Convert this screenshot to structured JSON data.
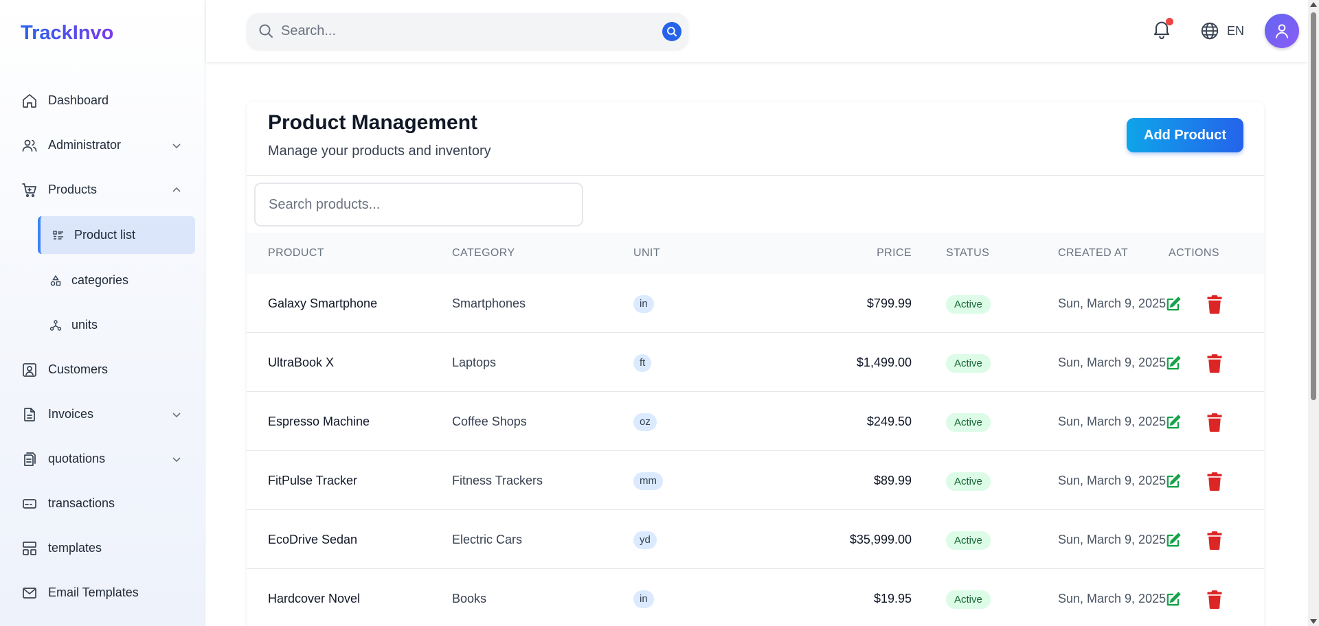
{
  "brand": "TrackInvo",
  "sidebar": {
    "items": [
      {
        "label": "Dashboard"
      },
      {
        "label": "Administrator"
      },
      {
        "label": "Products"
      },
      {
        "label": "Product list"
      },
      {
        "label": "categories"
      },
      {
        "label": "units"
      },
      {
        "label": "Customers"
      },
      {
        "label": "Invoices"
      },
      {
        "label": "quotations"
      },
      {
        "label": "transactions"
      },
      {
        "label": "templates"
      },
      {
        "label": "Email Templates"
      }
    ]
  },
  "header": {
    "search_placeholder": "Search...",
    "language": "EN"
  },
  "main": {
    "title": "Product Management",
    "subtitle": "Manage your products and inventory",
    "add_button": "Add Product",
    "search_placeholder": "Search products...",
    "columns": [
      "PRODUCT",
      "CATEGORY",
      "UNIT",
      "PRICE",
      "STATUS",
      "CREATED AT",
      "ACTIONS"
    ],
    "rows": [
      {
        "product": "Galaxy Smartphone",
        "category": "Smartphones",
        "unit": "in",
        "price": "$799.99",
        "status": "Active",
        "created": "Sun, March 9, 2025"
      },
      {
        "product": "UltraBook X",
        "category": "Laptops",
        "unit": "ft",
        "price": "$1,499.00",
        "status": "Active",
        "created": "Sun, March 9, 2025"
      },
      {
        "product": "Espresso Machine",
        "category": "Coffee Shops",
        "unit": "oz",
        "price": "$249.50",
        "status": "Active",
        "created": "Sun, March 9, 2025"
      },
      {
        "product": "FitPulse Tracker",
        "category": "Fitness Trackers",
        "unit": "mm",
        "price": "$89.99",
        "status": "Active",
        "created": "Sun, March 9, 2025"
      },
      {
        "product": "EcoDrive Sedan",
        "category": "Electric Cars",
        "unit": "yd",
        "price": "$35,999.00",
        "status": "Active",
        "created": "Sun, March 9, 2025"
      },
      {
        "product": "Hardcover Novel",
        "category": "Books",
        "unit": "in",
        "price": "$19.95",
        "status": "Active",
        "created": "Sun, March 9, 2025"
      }
    ]
  },
  "colors": {
    "brand": "#4f46e5",
    "primary": "#2563eb",
    "active_badge_bg": "#dcfce7",
    "edit_icon": "#16a34a",
    "delete_icon": "#dc2626",
    "notification_dot": "#ef4444"
  }
}
